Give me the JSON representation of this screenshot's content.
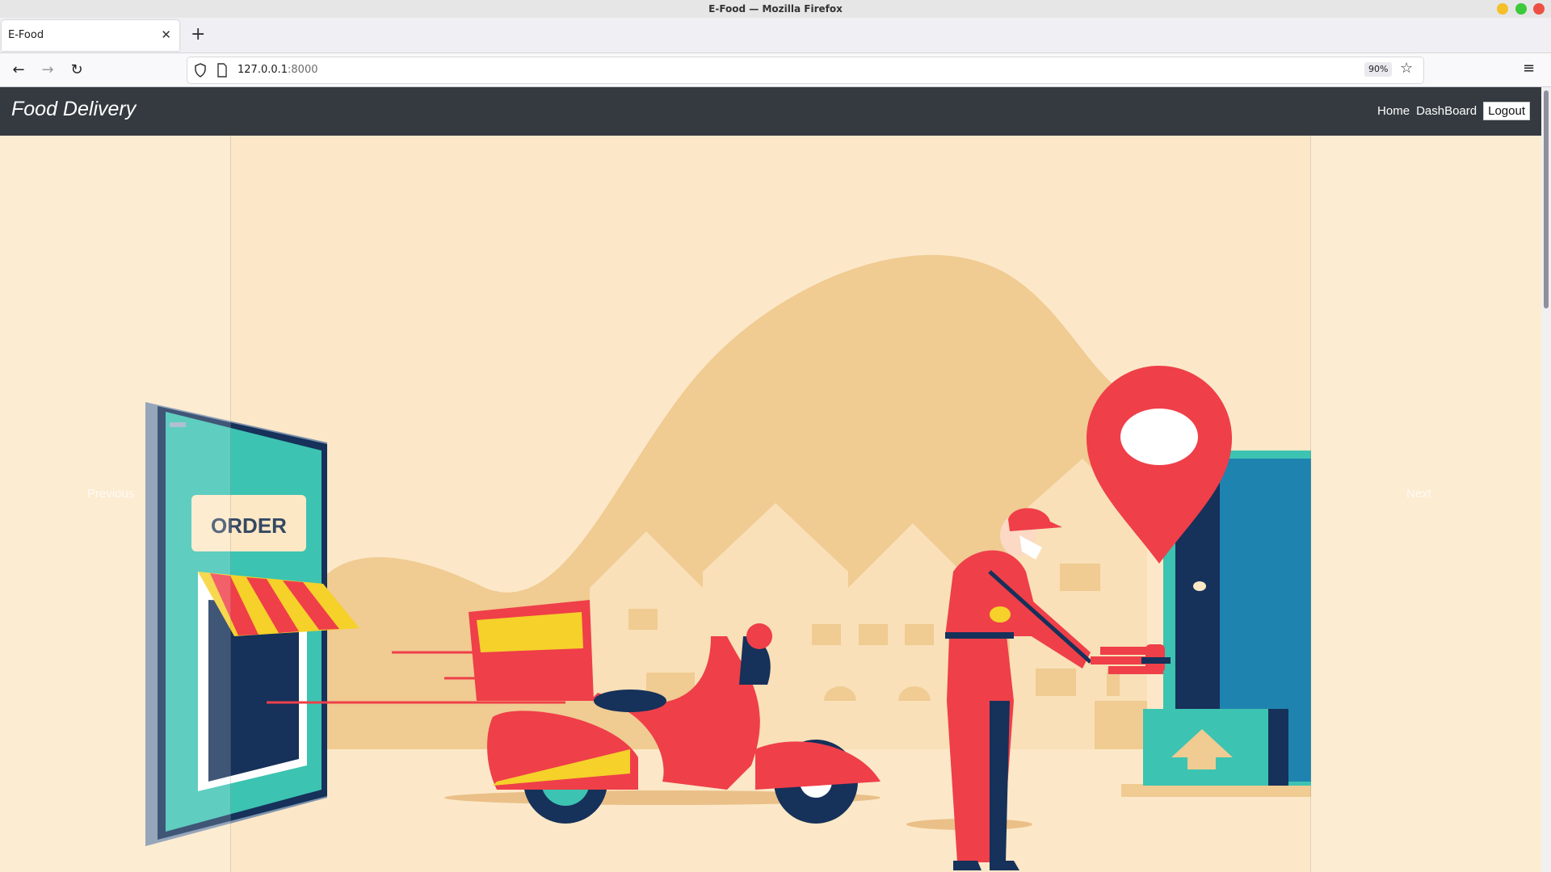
{
  "browser": {
    "window_title": "E-Food — Mozilla Firefox",
    "tab_title": "E-Food",
    "url_host": "127.0.0.1",
    "url_port": ":8000",
    "zoom": "90%"
  },
  "site": {
    "brand": "Food Delivery",
    "nav": {
      "home": "Home",
      "dashboard": "DashBoard",
      "logout": "Logout"
    }
  },
  "carousel": {
    "sign_text": "ORDER",
    "prev_label": "Previous",
    "next_label": "Next"
  },
  "colors": {
    "navbar_bg": "#343a40",
    "hero_bg": "#fce8c8",
    "accent_red": "#ef3f49",
    "accent_yellow": "#f5d12a",
    "teal": "#3cc3b1",
    "navy": "#16315a"
  }
}
